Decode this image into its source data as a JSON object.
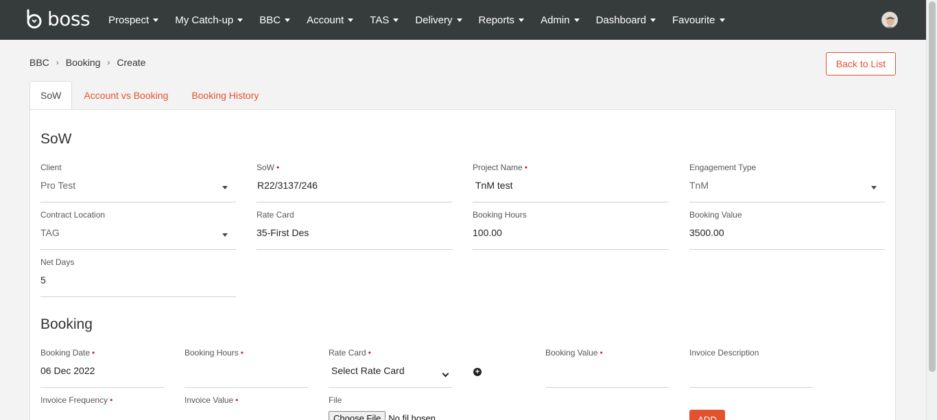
{
  "app": {
    "logo_text": "boss",
    "logo_icon": "boss-logo-icon"
  },
  "nav": {
    "items": [
      {
        "label": "Prospect"
      },
      {
        "label": "My Catch-up"
      },
      {
        "label": "BBC"
      },
      {
        "label": "Account"
      },
      {
        "label": "TAS"
      },
      {
        "label": "Delivery"
      },
      {
        "label": "Reports"
      },
      {
        "label": "Admin"
      },
      {
        "label": "Dashboard"
      },
      {
        "label": "Favourite"
      }
    ]
  },
  "breadcrumb": {
    "items": [
      "BBC",
      "Booking",
      "Create"
    ],
    "separator": "›"
  },
  "back_button": "Back to List",
  "tabs": [
    {
      "label": "SoW",
      "active": true
    },
    {
      "label": "Account vs Booking",
      "active": false
    },
    {
      "label": "Booking History",
      "active": false
    }
  ],
  "sow": {
    "title": "SoW",
    "client": {
      "label": "Client",
      "value": "Pro Test"
    },
    "sow": {
      "label": "SoW",
      "value": "R22/3137/246"
    },
    "project_name": {
      "label": "Project Name",
      "value": "TnM test"
    },
    "engagement_type": {
      "label": "Engagement Type",
      "value": "TnM"
    },
    "contract_location": {
      "label": "Contract Location",
      "value": "TAG"
    },
    "rate_card": {
      "label": "Rate Card",
      "value": "35-First Des"
    },
    "booking_hours": {
      "label": "Booking Hours",
      "value": "100.00"
    },
    "booking_value": {
      "label": "Booking Value",
      "value": "3500.00"
    },
    "net_days": {
      "label": "Net Days",
      "value": "5"
    }
  },
  "booking": {
    "title": "Booking",
    "booking_date": {
      "label": "Booking Date",
      "value": "06 Dec 2022"
    },
    "booking_hours": {
      "label": "Booking Hours",
      "value": ""
    },
    "rate_card": {
      "label": "Rate Card",
      "value": "Select Rate Card"
    },
    "booking_value": {
      "label": "Booking Value",
      "value": ""
    },
    "invoice_description": {
      "label": "Invoice Description",
      "value": ""
    },
    "invoice_frequency": {
      "label": "Invoice Frequency"
    },
    "invoice_value": {
      "label": "Invoice Value"
    },
    "file": {
      "label": "File",
      "button": "Choose File",
      "status": "No fil  hosen"
    },
    "add_button": "ADD"
  },
  "colors": {
    "accent": "#e4512e",
    "topbar": "#363b3b",
    "required": "#d0202a"
  }
}
